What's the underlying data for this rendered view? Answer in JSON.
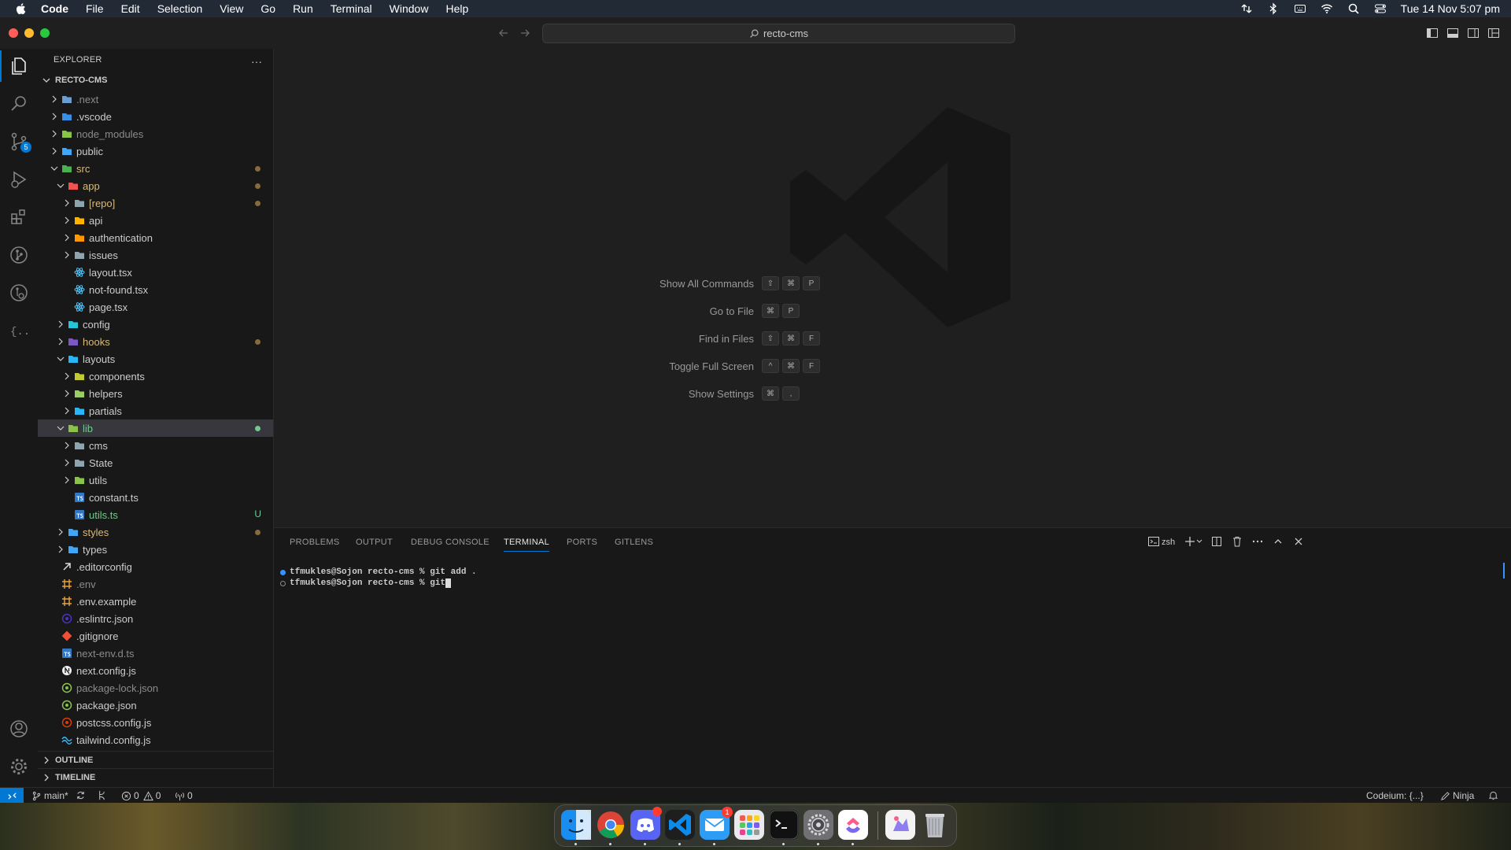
{
  "menubar": {
    "app": "Code",
    "items": [
      "File",
      "Edit",
      "Selection",
      "View",
      "Go",
      "Run",
      "Terminal",
      "Window",
      "Help"
    ],
    "clock": "Tue 14 Nov  5:07 pm"
  },
  "titlebar": {
    "search": "recto-cms"
  },
  "activity_bar": {
    "scm_badge": "5"
  },
  "sidebar": {
    "title": "EXPLORER",
    "more": "···",
    "root": "RECTO-CMS",
    "tree": [
      {
        "label": ".next",
        "depth": 0,
        "chev": "right",
        "icon": "folder-next",
        "color": "#8b8b8b"
      },
      {
        "label": ".vscode",
        "depth": 0,
        "chev": "right",
        "icon": "folder-vscode",
        "color": "#cccccc"
      },
      {
        "label": "node_modules",
        "depth": 0,
        "chev": "right",
        "icon": "folder-node",
        "color": "#8b8b8b"
      },
      {
        "label": "public",
        "depth": 0,
        "chev": "right",
        "icon": "folder-public",
        "color": "#cccccc"
      },
      {
        "label": "src",
        "depth": 0,
        "chev": "down",
        "icon": "folder-src",
        "color": "#d7ba7d",
        "deco": "dot"
      },
      {
        "label": "app",
        "depth": 1,
        "chev": "down",
        "icon": "folder-app",
        "color": "#d7ba7d",
        "deco": "dot"
      },
      {
        "label": "[repo]",
        "depth": 2,
        "chev": "right",
        "icon": "folder",
        "color": "#d7ba7d",
        "deco": "dot"
      },
      {
        "label": "api",
        "depth": 2,
        "chev": "right",
        "icon": "folder-api",
        "color": "#cccccc"
      },
      {
        "label": "authentication",
        "depth": 2,
        "chev": "right",
        "icon": "folder-auth",
        "color": "#cccccc"
      },
      {
        "label": "issues",
        "depth": 2,
        "chev": "right",
        "icon": "folder",
        "color": "#cccccc"
      },
      {
        "label": "layout.tsx",
        "depth": 2,
        "chev": "none",
        "icon": "react",
        "color": "#cccccc"
      },
      {
        "label": "not-found.tsx",
        "depth": 2,
        "chev": "none",
        "icon": "react",
        "color": "#cccccc"
      },
      {
        "label": "page.tsx",
        "depth": 2,
        "chev": "none",
        "icon": "react",
        "color": "#cccccc"
      },
      {
        "label": "config",
        "depth": 1,
        "chev": "right",
        "icon": "folder-config",
        "color": "#cccccc"
      },
      {
        "label": "hooks",
        "depth": 1,
        "chev": "right",
        "icon": "folder-hooks",
        "color": "#d7ba7d",
        "deco": "dot"
      },
      {
        "label": "layouts",
        "depth": 1,
        "chev": "down",
        "icon": "folder-layouts",
        "color": "#cccccc"
      },
      {
        "label": "components",
        "depth": 2,
        "chev": "right",
        "icon": "folder-components",
        "color": "#cccccc"
      },
      {
        "label": "helpers",
        "depth": 2,
        "chev": "right",
        "icon": "folder-helpers",
        "color": "#cccccc"
      },
      {
        "label": "partials",
        "depth": 2,
        "chev": "right",
        "icon": "folder-partials",
        "color": "#cccccc"
      },
      {
        "label": "lib",
        "depth": 1,
        "chev": "down",
        "icon": "folder-lib",
        "color": "#73c991",
        "deco": "green",
        "selected": true
      },
      {
        "label": "cms",
        "depth": 2,
        "chev": "right",
        "icon": "folder",
        "color": "#cccccc"
      },
      {
        "label": "State",
        "depth": 2,
        "chev": "right",
        "icon": "folder",
        "color": "#cccccc"
      },
      {
        "label": "utils",
        "depth": 2,
        "chev": "right",
        "icon": "folder-utils",
        "color": "#cccccc"
      },
      {
        "label": "constant.ts",
        "depth": 2,
        "chev": "none",
        "icon": "ts",
        "color": "#cccccc"
      },
      {
        "label": "utils.ts",
        "depth": 2,
        "chev": "none",
        "icon": "ts",
        "color": "#73c991",
        "deco": "U"
      },
      {
        "label": "styles",
        "depth": 1,
        "chev": "right",
        "icon": "folder-styles",
        "color": "#d7ba7d",
        "deco": "dot"
      },
      {
        "label": "types",
        "depth": 1,
        "chev": "right",
        "icon": "folder-types",
        "color": "#cccccc"
      },
      {
        "label": ".editorconfig",
        "depth": 0,
        "chev": "none",
        "icon": "editorconfig",
        "color": "#cccccc"
      },
      {
        "label": ".env",
        "depth": 0,
        "chev": "none",
        "icon": "env",
        "color": "#8b8b8b"
      },
      {
        "label": ".env.example",
        "depth": 0,
        "chev": "none",
        "icon": "env",
        "color": "#cccccc"
      },
      {
        "label": ".eslintrc.json",
        "depth": 0,
        "chev": "none",
        "icon": "eslint",
        "color": "#cccccc"
      },
      {
        "label": ".gitignore",
        "depth": 0,
        "chev": "none",
        "icon": "git",
        "color": "#cccccc"
      },
      {
        "label": "next-env.d.ts",
        "depth": 0,
        "chev": "none",
        "icon": "ts",
        "color": "#8b8b8b"
      },
      {
        "label": "next.config.js",
        "depth": 0,
        "chev": "none",
        "icon": "next",
        "color": "#cccccc"
      },
      {
        "label": "package-lock.json",
        "depth": 0,
        "chev": "none",
        "icon": "npm",
        "color": "#8b8b8b"
      },
      {
        "label": "package.json",
        "depth": 0,
        "chev": "none",
        "icon": "npm",
        "color": "#cccccc"
      },
      {
        "label": "postcss.config.js",
        "depth": 0,
        "chev": "none",
        "icon": "postcss",
        "color": "#cccccc"
      },
      {
        "label": "tailwind.config.js",
        "depth": 0,
        "chev": "none",
        "icon": "tailwind",
        "color": "#cccccc"
      }
    ],
    "outline": "OUTLINE",
    "timeline": "TIMELINE"
  },
  "editor": {
    "shortcuts": [
      {
        "label": "Show All Commands",
        "keys": [
          "⇧",
          "⌘",
          "P"
        ]
      },
      {
        "label": "Go to File",
        "keys": [
          "⌘",
          "P"
        ]
      },
      {
        "label": "Find in Files",
        "keys": [
          "⇧",
          "⌘",
          "F"
        ]
      },
      {
        "label": "Toggle Full Screen",
        "keys": [
          "^",
          "⌘",
          "F"
        ]
      },
      {
        "label": "Show Settings",
        "keys": [
          "⌘",
          ","
        ]
      }
    ]
  },
  "panel": {
    "tabs": [
      "PROBLEMS",
      "OUTPUT",
      "DEBUG CONSOLE",
      "TERMINAL",
      "PORTS",
      "GITLENS"
    ],
    "active_tab": "TERMINAL",
    "shell": "zsh",
    "terminal_lines": [
      "tfmukles@Sojon recto-cms % git add .",
      "tfmukles@Sojon recto-cms % git"
    ]
  },
  "statusbar": {
    "branch": "main*",
    "errors": "0",
    "warnings": "0",
    "ports": "0",
    "codeium": "Codeium: {...}",
    "ninja": "Ninja"
  },
  "dock": {
    "apps": [
      "finder",
      "chrome",
      "discord",
      "vscode",
      "mail",
      "launchpad",
      "terminal",
      "system-settings",
      "clickup",
      "preview",
      "trash"
    ],
    "badges": {
      "discord": "",
      "mail": "1"
    }
  },
  "colors": {
    "accent": "#0078d4",
    "modified": "#d7ba7d",
    "untracked": "#73c991"
  }
}
